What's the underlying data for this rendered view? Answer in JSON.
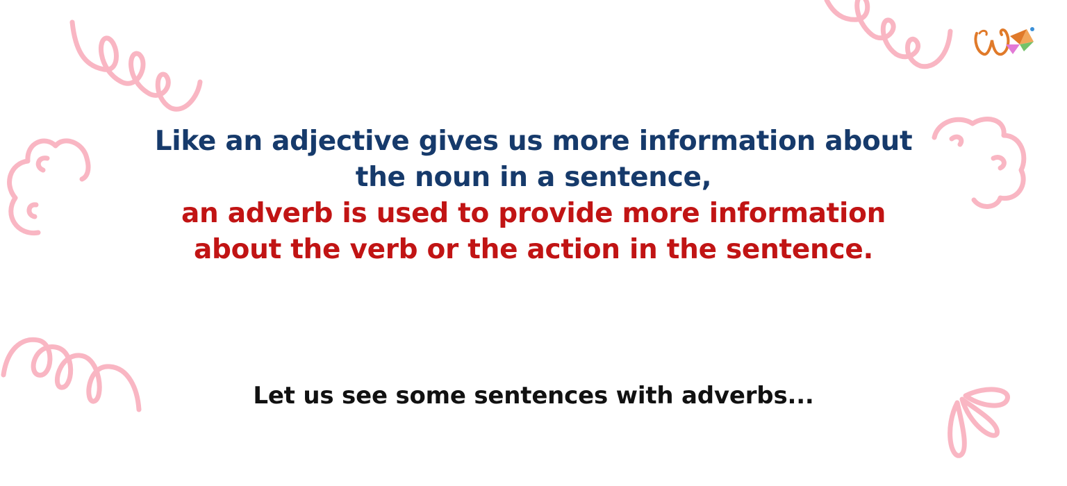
{
  "content": {
    "lead_line_1": "Like an adjective gives us more information about",
    "lead_line_2": "the noun in a sentence,",
    "highlight_line_1": "an adverb is used to provide more information",
    "highlight_line_2": "about the verb or the action in the sentence.",
    "prompt": "Let us see some sentences with adverbs..."
  },
  "colors": {
    "navy_text": "#163a6b",
    "red_text": "#c11414",
    "doodle_pink": "#f9b6c3",
    "logo_orange": "#e07a2a"
  },
  "icons": [
    "squiggle-doodle",
    "cloud-doodle",
    "petal-doodle",
    "brand-logo"
  ]
}
